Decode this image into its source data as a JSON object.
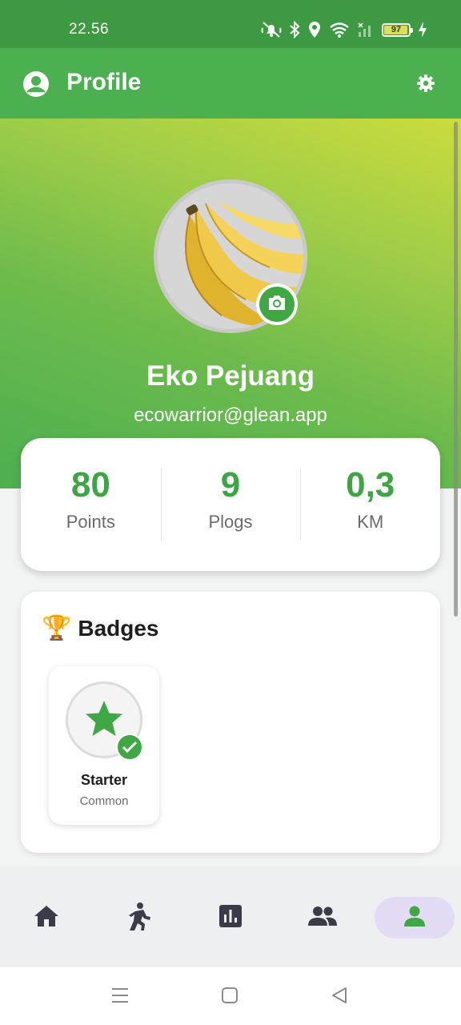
{
  "status_bar": {
    "time": "22.56",
    "battery_level": "97",
    "battery_fraction": 0.97,
    "icons": [
      "mute-vibrate-icon",
      "bluetooth-icon",
      "location-icon",
      "wifi-icon",
      "signal-icon",
      "battery-icon",
      "charging-icon"
    ]
  },
  "app_bar": {
    "title": "Profile",
    "leading_icon": "account-circle-icon",
    "action_icon": "gear-icon"
  },
  "profile": {
    "name": "Eko Pejuang",
    "email": "ecowarrior@glean.app",
    "avatar": "banana-photo",
    "camera_icon": "camera-icon"
  },
  "stats": [
    {
      "value": "80",
      "label": "Points"
    },
    {
      "value": "9",
      "label": "Plogs"
    },
    {
      "value": "0,3",
      "label": "KM"
    }
  ],
  "badges": {
    "title_emoji": "🏆",
    "title": "Badges",
    "items": [
      {
        "name": "Starter",
        "rarity": "Common",
        "icon": "star-icon",
        "earned": true
      }
    ]
  },
  "bottom_nav": {
    "items": [
      {
        "icon": "home-icon",
        "active": false
      },
      {
        "icon": "plogger-icon",
        "active": false
      },
      {
        "icon": "bar-chart-icon",
        "active": false
      },
      {
        "icon": "group-icon",
        "active": false
      },
      {
        "icon": "person-icon",
        "active": true
      }
    ]
  },
  "system_nav": {
    "buttons": [
      "menu-icon",
      "home-square-icon",
      "back-triangle-icon"
    ]
  },
  "colors": {
    "primary": "#4caf50",
    "status_bar": "#3e9a42",
    "stat_value": "#3da544",
    "active_nav_pill": "#e4dcf5"
  }
}
